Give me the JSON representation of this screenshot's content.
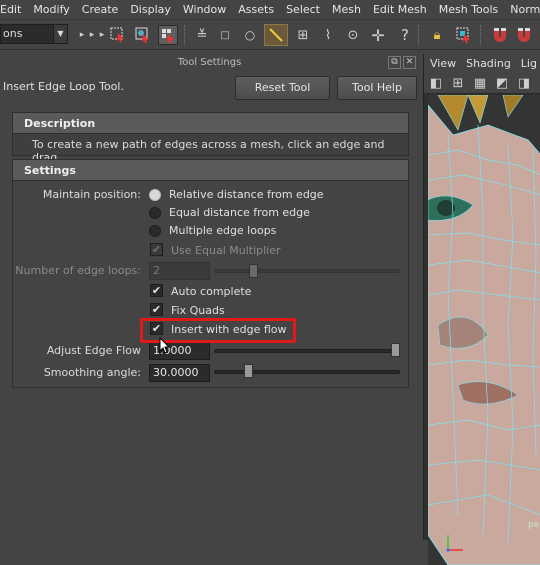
{
  "menubar": {
    "items": [
      "Edit",
      "Modify",
      "Create",
      "Display",
      "Window",
      "Assets",
      "Select",
      "Mesh",
      "Edit Mesh",
      "Mesh Tools",
      "Normals"
    ]
  },
  "toolbar": {
    "mode_value": "ons",
    "icons": [
      "arrow-select-icon",
      "lasso-icon",
      "paint-select-icon",
      "component-icon",
      "soft-select-icon",
      "cube-icon",
      "sphere-icon",
      "multicut-icon",
      "grid-icon",
      "curve-icon",
      "target-icon",
      "plus-icon",
      "help-icon",
      "lock-icon",
      "snap-icon",
      "magnet-icon"
    ]
  },
  "panel": {
    "title": "Tool Settings",
    "tool_name": "Insert Edge Loop Tool.",
    "reset_label": "Reset Tool",
    "help_label": "Tool Help"
  },
  "description": {
    "header": "Description",
    "text": "To create a new path of edges across a mesh, click an edge and drag."
  },
  "settings": {
    "header": "Settings",
    "maintain_label": "Maintain position:",
    "radio_options": [
      "Relative distance from edge",
      "Equal distance from edge",
      "Multiple edge loops"
    ],
    "radio_selected": 0,
    "use_equal_multiplier": "Use Equal Multiplier",
    "num_loops_label": "Number of edge loops:",
    "num_loops_value": "2",
    "auto_complete": "Auto complete",
    "fix_quads": "Fix Quads",
    "insert_edge_flow": "Insert with edge flow",
    "adjust_flow_label": "Adjust Edge Flow",
    "adjust_flow_value": "1.0000",
    "adjust_flow_fraction": 1.0,
    "smoothing_label": "Smoothing angle:",
    "smoothing_value": "30.0000",
    "smoothing_fraction": 0.17
  },
  "viewport": {
    "menu": [
      "View",
      "Shading",
      "Lig"
    ],
    "corner_label": "pe"
  },
  "colors": {
    "highlight": "#e0191b",
    "wire": "#7fe3f2",
    "skin": "#c9a89e"
  }
}
